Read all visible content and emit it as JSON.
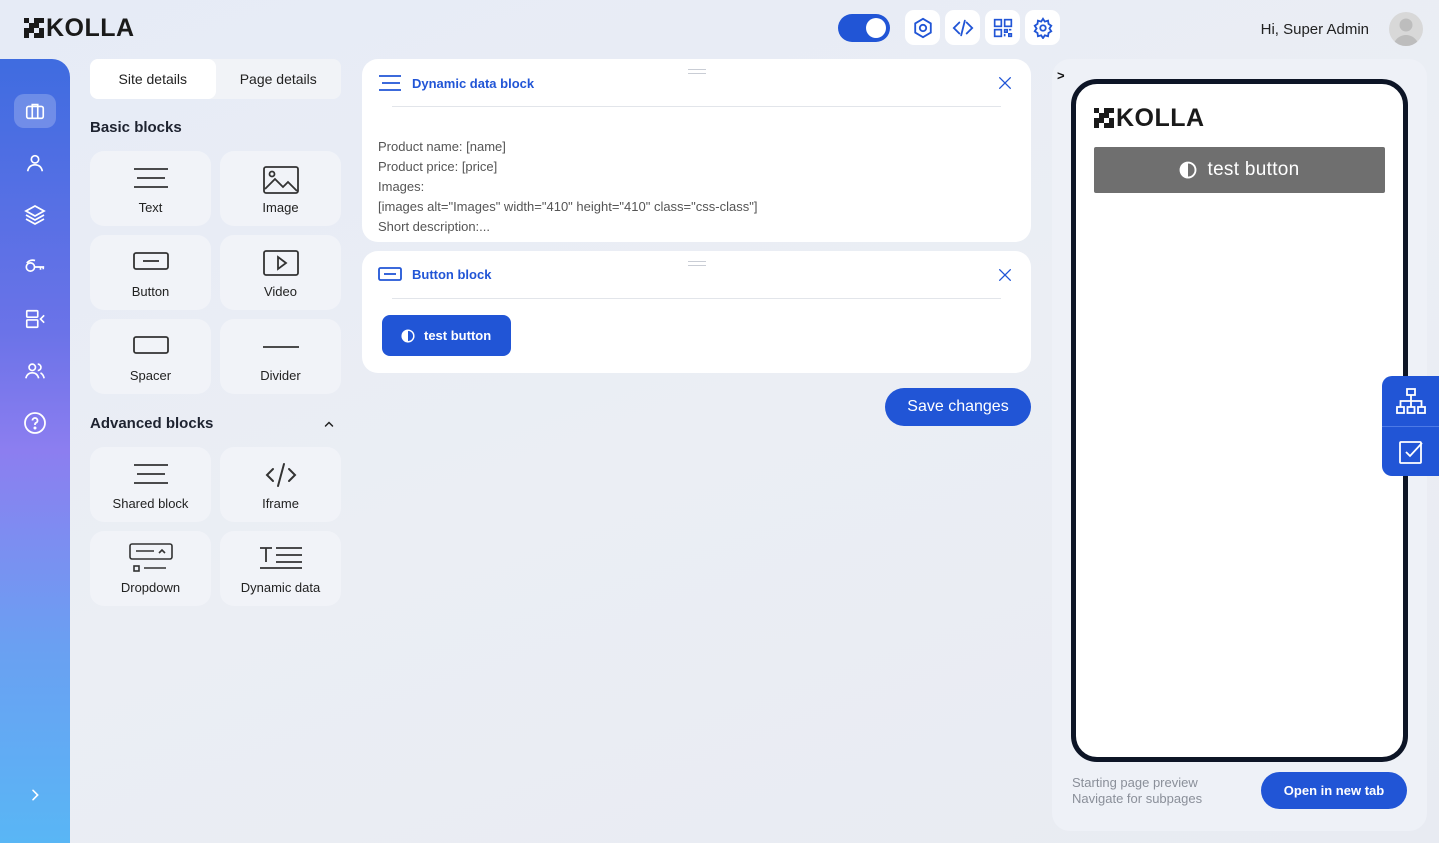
{
  "header": {
    "logo_text": "KOLLA",
    "greeting": "Hi, Super Admin"
  },
  "icons": {
    "tools": [
      "hexagon-settings-icon",
      "code-icon",
      "qr-code-icon",
      "gear-icon"
    ],
    "rail": [
      "briefcase-icon",
      "user-icon",
      "layers-icon",
      "key-icon",
      "inbox-icon",
      "users-icon",
      "help-icon",
      "chevron-right-icon"
    ]
  },
  "panel": {
    "tabs": [
      {
        "label": "Site details",
        "active": true
      },
      {
        "label": "Page details",
        "active": false
      }
    ],
    "basic_title": "Basic blocks",
    "advanced_title": "Advanced blocks",
    "basic_blocks": [
      "Text",
      "Image",
      "Button",
      "Video",
      "Spacer",
      "Divider"
    ],
    "advanced_blocks": [
      "Shared block",
      "Iframe",
      "Dropdown",
      "Dynamic data"
    ]
  },
  "cards": {
    "dynamic": {
      "title": "Dynamic data block",
      "lines": [
        "Product name: [name]",
        "Product price: [price]",
        "Images:",
        "[images alt=\"Images\" width=\"410\" height=\"410\" class=\"css-class\"]",
        "Short description:..."
      ]
    },
    "button": {
      "title": "Button block",
      "button_label": "test button"
    },
    "save_label": "Save changes"
  },
  "preview": {
    "collapse_label": ">",
    "logo_text": "KOLLA",
    "button_label": "test button",
    "note_line1": "Starting page preview",
    "note_line2": "Navigate for subpages",
    "open_label": "Open in new tab"
  },
  "colors": {
    "accent": "#2155d6",
    "preview_button": "#6f6f6f"
  }
}
